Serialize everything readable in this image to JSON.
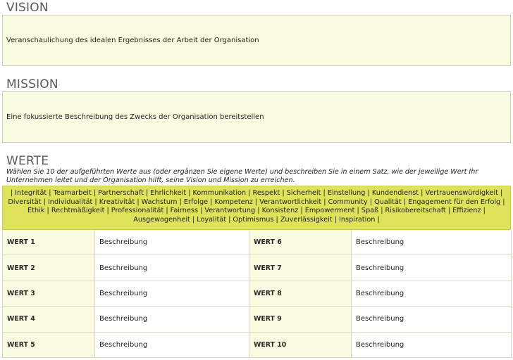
{
  "vision": {
    "heading": "VISION",
    "text": "Veranschaulichung des idealen Ergebnisses der Arbeit der Organisation"
  },
  "mission": {
    "heading": "MISSION",
    "text": "Eine fokussierte Beschreibung des Zwecks der Organisation bereitstellen"
  },
  "werte": {
    "heading": "WERTE",
    "instruction": "Wählen Sie 10 der aufgeführten Werte aus (oder ergänzen Sie eigene Werte) und beschreiben Sie in einem Satz, wie der jeweilige Wert Ihr Unternehmen leitet und der Organisation hilft, seine Vision und Mission zu erreichen.",
    "values_list": "| Integrität | Teamarbeit | Partnerschaft | Ehrlichkeit | Kommunikation | Respekt | Sicherheit | Einstellung | Kundendienst | Vertrauenswürdigkeit | Diversität | Individualität | Kreativität | Wachstum | Erfolge | Kompetenz | Verantwortlichkeit | Community | Qualität | Engagement für den Erfolg | Ethik | Rechtmäßigkeit | Professionalität | Fairness | Verantwortung | Konsistenz | Empowerment | Spaß | Risikobereitschaft | Effizienz | Ausgewogenheit | Loyalität | Optimismus | Zuverlässigkeit | Inspiration |",
    "rows": [
      {
        "left_label": "WERT 1",
        "left_desc": "Beschreibung",
        "right_label": "WERT 6",
        "right_desc": "Beschreibung"
      },
      {
        "left_label": "WERT 2",
        "left_desc": "Beschreibung",
        "right_label": "WERT 7",
        "right_desc": "Beschreibung"
      },
      {
        "left_label": "WERT 3",
        "left_desc": "Beschreibung",
        "right_label": "WERT 8",
        "right_desc": "Beschreibung"
      },
      {
        "left_label": "WERT 4",
        "left_desc": "Beschreibung",
        "right_label": "WERT 9",
        "right_desc": "Beschreibung"
      },
      {
        "left_label": "WERT 5",
        "left_desc": "Beschreibung",
        "right_label": "WERT 10",
        "right_desc": "Beschreibung"
      }
    ]
  },
  "colors": {
    "box_fill": "#fbfbe1",
    "values_band": "#dfe35a",
    "heading_text": "#5a5a5a"
  }
}
